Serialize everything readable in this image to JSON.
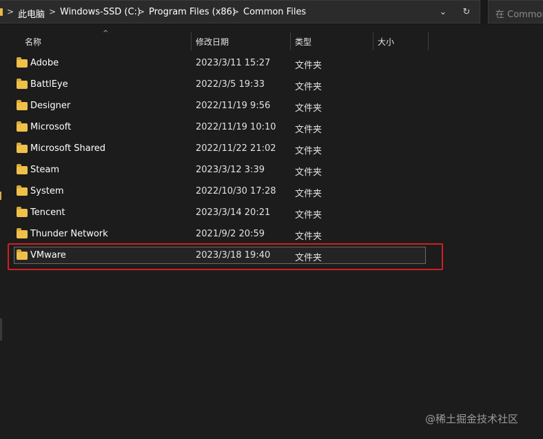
{
  "address_bar": {
    "crumbs": [
      "此电脑",
      "Windows-SSD (C:)",
      "Program Files (x86)",
      "Common Files"
    ],
    "separator": ">",
    "dropdown_icon": "chevron-down",
    "refresh_icon": "refresh"
  },
  "search": {
    "placeholder": "在 Common"
  },
  "columns": {
    "name": "名称",
    "date": "修改日期",
    "type": "类型",
    "size": "大小"
  },
  "rows": [
    {
      "name": "Adobe",
      "date": "2023/3/11 15:27",
      "type": "文件夹"
    },
    {
      "name": "BattlEye",
      "date": "2022/3/5 19:33",
      "type": "文件夹"
    },
    {
      "name": "Designer",
      "date": "2022/11/19 9:56",
      "type": "文件夹"
    },
    {
      "name": "Microsoft",
      "date": "2022/11/19 10:10",
      "type": "文件夹"
    },
    {
      "name": "Microsoft Shared",
      "date": "2022/11/22 21:02",
      "type": "文件夹"
    },
    {
      "name": "Steam",
      "date": "2023/3/12 3:39",
      "type": "文件夹"
    },
    {
      "name": "System",
      "date": "2022/10/30 17:28",
      "type": "文件夹"
    },
    {
      "name": "Tencent",
      "date": "2023/3/14 20:21",
      "type": "文件夹"
    },
    {
      "name": "Thunder Network",
      "date": "2021/9/2 20:59",
      "type": "文件夹"
    },
    {
      "name": "VMware",
      "date": "2023/3/18 19:40",
      "type": "文件夹"
    }
  ],
  "selected_row": "VMware",
  "highlight_color": "#d41f1f",
  "folder_color": "#f0c04a",
  "watermark": "@稀土掘金技术社区"
}
